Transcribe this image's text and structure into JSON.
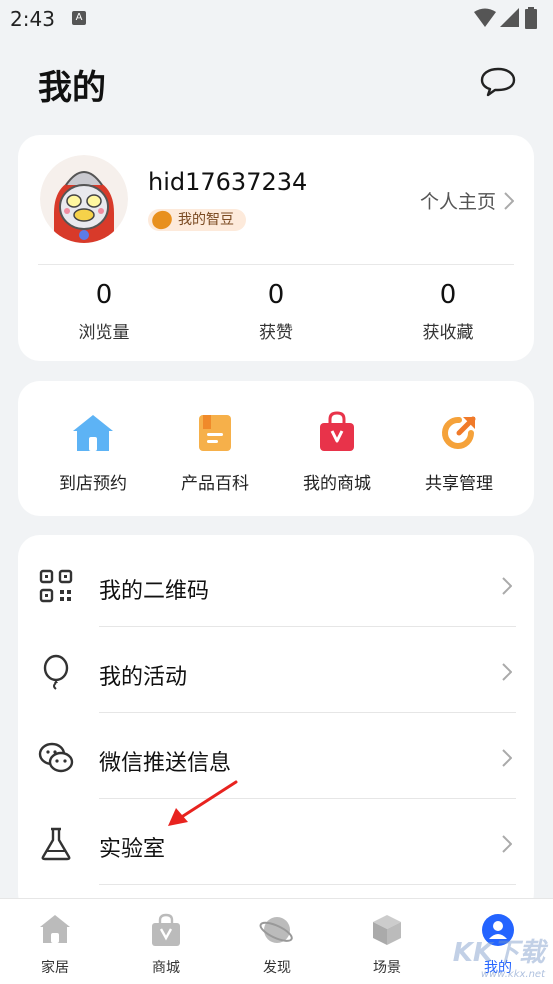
{
  "status_bar": {
    "time": "2:43",
    "notification_letter": "A"
  },
  "header": {
    "title": "我的",
    "message_icon": "message-bubble-icon"
  },
  "profile": {
    "username": "hid17637234",
    "badge_label": "我的智豆",
    "homepage_label": "个人主页",
    "stats": [
      {
        "value": "0",
        "label": "浏览量"
      },
      {
        "value": "0",
        "label": "获赞"
      },
      {
        "value": "0",
        "label": "获收藏"
      }
    ]
  },
  "quick_actions": [
    {
      "label": "到店预约",
      "icon": "store-house-icon",
      "color": "#4aa8f0"
    },
    {
      "label": "产品百科",
      "icon": "book-icon",
      "color": "#f4a43a"
    },
    {
      "label": "我的商城",
      "icon": "shopping-bag-icon",
      "color": "#e8334a"
    },
    {
      "label": "共享管理",
      "icon": "share-icon",
      "color": "#f59a2f"
    }
  ],
  "menu": [
    {
      "label": "我的二维码",
      "icon": "qr-code-icon"
    },
    {
      "label": "我的活动",
      "icon": "balloon-icon"
    },
    {
      "label": "微信推送信息",
      "icon": "wechat-icon"
    },
    {
      "label": "实验室",
      "icon": "flask-icon"
    }
  ],
  "tabs": [
    {
      "label": "家居",
      "icon": "home-icon"
    },
    {
      "label": "商城",
      "icon": "bag-icon"
    },
    {
      "label": "发现",
      "icon": "planet-icon"
    },
    {
      "label": "场景",
      "icon": "cube-icon"
    },
    {
      "label": "我的",
      "icon": "person-icon",
      "active": true
    }
  ],
  "watermark": {
    "text": "KK下载",
    "url": "www.kkx.net"
  },
  "colors": {
    "accent": "#2464ff",
    "background": "#f1f3f5"
  }
}
